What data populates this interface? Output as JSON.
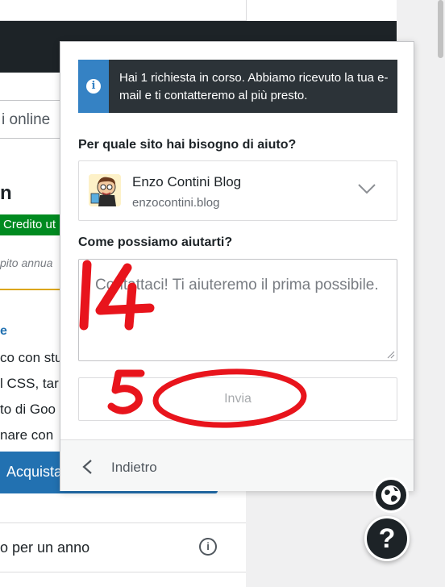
{
  "background": {
    "search_partial": "i online",
    "heading_partial": "n",
    "badge_partial": "Credito ut",
    "italic_partial": "pito annua",
    "link_partial": "e",
    "lines_partial": [
      "co con stu",
      "l CSS, tar",
      "to di Goo",
      "nare con"
    ],
    "buy_button_partial": "Acquista",
    "feature_row": "o per un anno",
    "info_icon": "i"
  },
  "notice": {
    "icon": "info-icon",
    "text": "Hai 1 richiesta in corso. Abbiamo ricevuto la tua e-mail e ti contatteremo al più presto."
  },
  "form": {
    "site_label": "Per quale sito hai bisogno di aiuto?",
    "site": {
      "name": "Enzo Contini Blog",
      "url": "enzocontini.blog"
    },
    "message_label": "Come possiamo aiutarti?",
    "message_placeholder": "Contattaci! Ti aiuteremo il prima possibile.",
    "submit_label": "Invia"
  },
  "footer": {
    "back_label": "Indietro"
  },
  "floating": {
    "help_label": "?"
  },
  "annotations": {
    "color": "#e8141c",
    "number_a": "14",
    "number_b": "5"
  },
  "colors": {
    "notice_bg": "#2c3338",
    "notice_accent": "#3582c4",
    "badge_green": "#008a20",
    "primary_blue": "#2271b1"
  }
}
